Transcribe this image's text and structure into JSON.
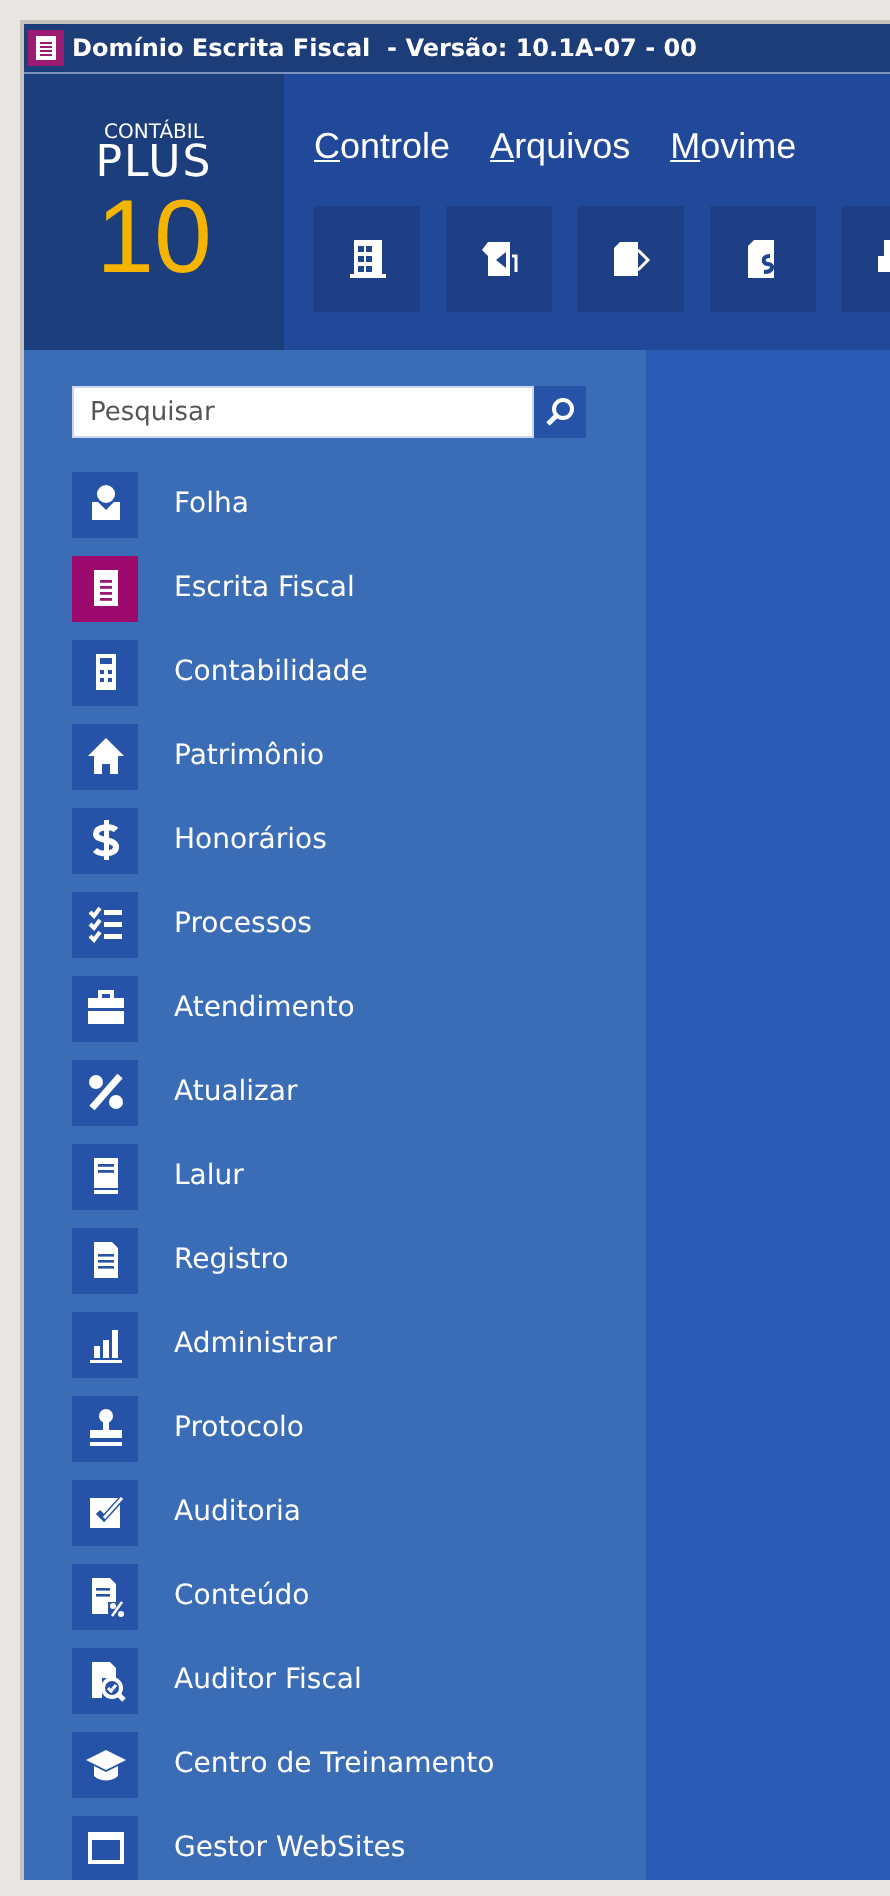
{
  "window": {
    "title": "Domínio Escrita Fiscal  - Versão: 10.1A-07 - 00"
  },
  "logo": {
    "line_1": "CONTÁBIL",
    "line_2": "PLUS",
    "line_3": "10"
  },
  "menu": [
    "Controle",
    "Arquivos",
    "Movime"
  ],
  "search": {
    "placeholder": "Pesquisar"
  },
  "sidebar": {
    "items": [
      {
        "label": "Folha",
        "selected": false
      },
      {
        "label": "Escrita Fiscal",
        "selected": true
      },
      {
        "label": "Contabilidade",
        "selected": false
      },
      {
        "label": "Patrimônio",
        "selected": false
      },
      {
        "label": "Honorários",
        "selected": false
      },
      {
        "label": "Processos",
        "selected": false
      },
      {
        "label": "Atendimento",
        "selected": false
      },
      {
        "label": "Atualizar",
        "selected": false
      },
      {
        "label": "Lalur",
        "selected": false
      },
      {
        "label": "Registro",
        "selected": false
      },
      {
        "label": "Administrar",
        "selected": false
      },
      {
        "label": "Protocolo",
        "selected": false
      },
      {
        "label": "Auditoria",
        "selected": false
      },
      {
        "label": "Conteúdo",
        "selected": false
      },
      {
        "label": "Auditor Fiscal",
        "selected": false
      },
      {
        "label": "Centro de Treinamento",
        "selected": false
      },
      {
        "label": "Gestor WebSites",
        "selected": false
      }
    ]
  }
}
